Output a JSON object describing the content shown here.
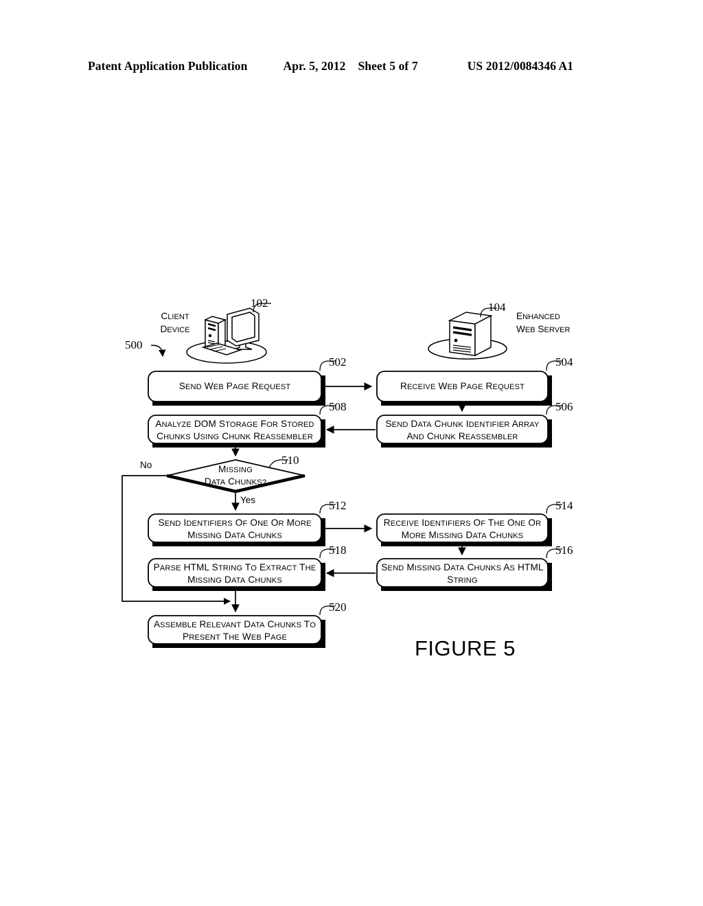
{
  "header": {
    "publication": "Patent Application Publication",
    "date": "Apr. 5, 2012",
    "sheet": "Sheet 5 of 7",
    "number": "US 2012/0084346 A1"
  },
  "figure": {
    "caption": "FIGURE 5",
    "diagram_ref": "500",
    "nodes": {
      "client_device": {
        "label_line1": "Client",
        "label_line2": "Device",
        "ref": "102"
      },
      "web_server": {
        "label_line1": "Enhanced",
        "label_line2": "Web Server",
        "ref": "104"
      }
    },
    "steps": [
      {
        "ref": "502",
        "line1": "Send Web Page Request",
        "line2": "",
        "column": "client"
      },
      {
        "ref": "504",
        "line1": "Receive Web Page Request",
        "line2": "",
        "column": "server"
      },
      {
        "ref": "508",
        "line1": "Analyze DOM Storage for Stored",
        "line2": "Chunks Using Chunk Reassembler",
        "column": "client"
      },
      {
        "ref": "506",
        "line1": "Send Data Chunk Identifier Array",
        "line2": "and Chunk Reassembler",
        "column": "server"
      },
      {
        "ref": "512",
        "line1": "Send Identifiers of One or More",
        "line2": "Missing Data Chunks",
        "column": "client"
      },
      {
        "ref": "514",
        "line1": "Receive Identifiers of the One or",
        "line2": "More Missing Data Chunks",
        "column": "server"
      },
      {
        "ref": "518",
        "line1": "Parse HTML String to Extract the",
        "line2": "Missing Data Chunks",
        "column": "client"
      },
      {
        "ref": "516",
        "line1": "Send Missing Data Chunks as HTML",
        "line2": "String",
        "column": "server"
      },
      {
        "ref": "520",
        "line1": "Assemble Relevant Data Chunks to",
        "line2": "Present the Web Page",
        "column": "client"
      }
    ],
    "decision": {
      "ref": "510",
      "line1": "Missing",
      "line2": "Data Chunks?",
      "branch_no": "No",
      "branch_yes": "Yes"
    },
    "colors": {
      "ink": "#000000",
      "paper": "#ffffff"
    }
  }
}
